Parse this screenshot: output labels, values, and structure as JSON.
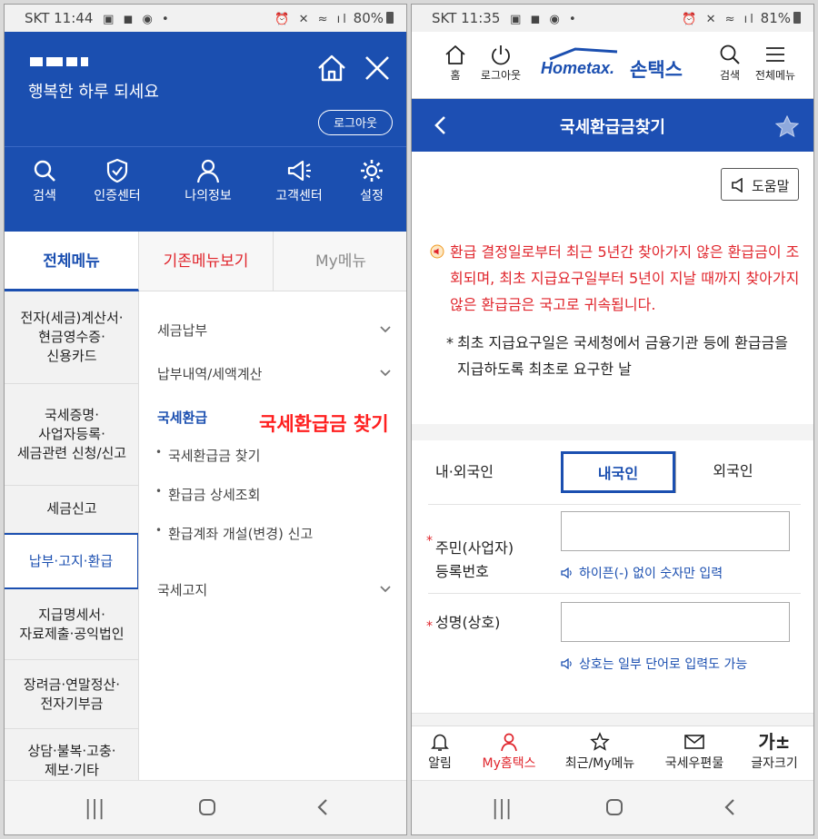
{
  "left": {
    "status": {
      "carrier": "SKT",
      "time": "11:44",
      "battery": "80%"
    },
    "header": {
      "greeting": "행복한 하루 되세요",
      "logout_label": "로그아웃",
      "quick_menu": [
        "검색",
        "인증센터",
        "나의정보",
        "고객센터",
        "설정"
      ]
    },
    "tabs": [
      "전체메뉴",
      "기존메뉴보기",
      "My메뉴"
    ],
    "sidebar_items": [
      "전자(세금)계산서·\n현금영수증·\n신용카드",
      "국세증명·\n사업자등록·\n세금관련 신청/신고",
      "세금신고",
      "납부·고지·환급",
      "지급명세서·\n자료제출·공익법인",
      "장려금·연말정산·\n전자기부금",
      "상담·불복·고충·\n제보·기타"
    ],
    "submenu": {
      "items": [
        "세금납부",
        "납부내역/세액계산",
        "국세환급",
        "국세고지"
      ],
      "refund_sub": [
        "국세환급금 찾기",
        "환급금 상세조회",
        "환급계좌 개설(변경) 신고"
      ]
    },
    "annotation": "국세환급금 찾기"
  },
  "right": {
    "status": {
      "carrier": "SKT",
      "time": "11:35",
      "battery": "81%"
    },
    "topbar": {
      "home_label": "홈",
      "logout_label": "로그아웃",
      "logo_en": "Hometax.",
      "logo_ko": "손택스",
      "search_label": "검색",
      "menu_label": "전체메뉴"
    },
    "title": "국세환급금찾기",
    "help_label": "도움말",
    "notice": "환급 결정일로부터 최근 5년간 찾아가지 않은 환급금이 조회되며, 최초 지급요구일부터 5년이 지날 때까지 찾아가지 않은 환급금은 국고로 귀속됩니다.",
    "note": "최초 지급요구일은 국세청에서 금융기관 등에 환급금을 지급하도록 최초로 요구한 날",
    "form": {
      "nationality_label": "내·외국인",
      "domestic_label": "내국인",
      "foreign_label": "외국인",
      "id_label": "주민(사업자)\n등록번호",
      "id_value": "",
      "id_hint": "하이픈(-) 없이 숫자만 입력",
      "name_label": "성명(상호)",
      "name_value": "",
      "name_hint": "상호는 일부 단어로 입력도 가능"
    },
    "bottom_tabs": [
      "알림",
      "My홈택스",
      "최근/My메뉴",
      "국세우편물",
      "글자크기"
    ],
    "font_size_glyph": "가±"
  },
  "colors": {
    "primary": "#1b4fb0",
    "accent_red": "#e0252c"
  }
}
